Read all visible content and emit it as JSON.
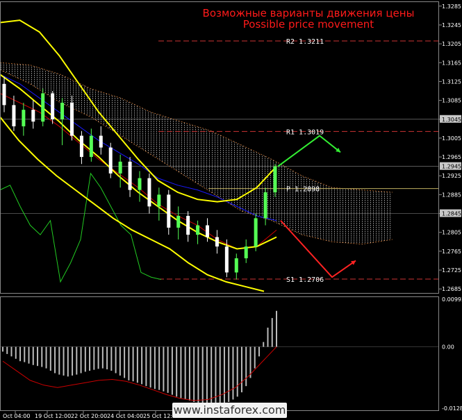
{
  "chart_data": {
    "type": "line",
    "title": "Возможные варианты движения цены",
    "subtitle": "Possible price movement",
    "colors": {
      "background": "#000000",
      "grid": "#555555",
      "candle_up": "#55ff55",
      "candle_down": "#ffffff",
      "bollinger": "#ffff00",
      "ma_blue": "#1a1aff",
      "ma_red": "#cc0000",
      "ma_green": "#22cc22",
      "cloud": "#c0c0c0",
      "cloud_edge": "#cc7a3a",
      "resistance_line": "#cc3333",
      "pivot_line": "#c0b060",
      "arrow_up": "#33ee33",
      "arrow_down": "#ff2222"
    },
    "price_axis": {
      "ticks": [
        "1.3285",
        "1.3245",
        "1.3205",
        "1.3165",
        "1.3125",
        "1.3085",
        "1.3045",
        "1.3005",
        "1.2965",
        "1.2925",
        "1.2885",
        "1.2845",
        "1.2805",
        "1.2765",
        "1.2725",
        "1.2685"
      ],
      "ylim": [
        1.2675,
        1.3295
      ],
      "current_labels": [
        "1.3045",
        "1.2945",
        "1.2845"
      ]
    },
    "levels": [
      {
        "name": "R2",
        "label": "R2 1.3211",
        "value": 1.3211
      },
      {
        "name": "R1",
        "label": "R1 1.3019",
        "value": 1.3019
      },
      {
        "name": "P",
        "label": "P 1.2898",
        "value": 1.2898
      },
      {
        "name": "S1",
        "label": "S1 1.2706",
        "value": 1.2706
      }
    ],
    "time_axis": {
      "labels": [
        "Oct 04:00",
        "19 Oct 12:00",
        "22 Oct 20:00",
        "24 Oct 04:00",
        "25 Oct 12:00"
      ]
    },
    "candles": [
      {
        "o": 1.312,
        "h": 1.3135,
        "l": 1.306,
        "c": 1.3075
      },
      {
        "o": 1.3075,
        "h": 1.3095,
        "l": 1.302,
        "c": 1.303
      },
      {
        "o": 1.303,
        "h": 1.308,
        "l": 1.301,
        "c": 1.3065
      },
      {
        "o": 1.3065,
        "h": 1.3085,
        "l": 1.3025,
        "c": 1.304
      },
      {
        "o": 1.304,
        "h": 1.311,
        "l": 1.303,
        "c": 1.31
      },
      {
        "o": 1.31,
        "h": 1.3105,
        "l": 1.3035,
        "c": 1.3045
      },
      {
        "o": 1.3045,
        "h": 1.309,
        "l": 1.299,
        "c": 1.308
      },
      {
        "o": 1.308,
        "h": 1.3095,
        "l": 1.3,
        "c": 1.301
      },
      {
        "o": 1.301,
        "h": 1.302,
        "l": 1.295,
        "c": 1.2965
      },
      {
        "o": 1.2965,
        "h": 1.3025,
        "l": 1.2955,
        "c": 1.301
      },
      {
        "o": 1.301,
        "h": 1.303,
        "l": 1.297,
        "c": 1.2985
      },
      {
        "o": 1.2985,
        "h": 1.2995,
        "l": 1.292,
        "c": 1.293
      },
      {
        "o": 1.293,
        "h": 1.297,
        "l": 1.29,
        "c": 1.2955
      },
      {
        "o": 1.2955,
        "h": 1.2965,
        "l": 1.288,
        "c": 1.2895
      },
      {
        "o": 1.2895,
        "h": 1.2935,
        "l": 1.287,
        "c": 1.292
      },
      {
        "o": 1.292,
        "h": 1.293,
        "l": 1.2845,
        "c": 1.286
      },
      {
        "o": 1.286,
        "h": 1.29,
        "l": 1.283,
        "c": 1.2885
      },
      {
        "o": 1.2885,
        "h": 1.2895,
        "l": 1.28,
        "c": 1.2815
      },
      {
        "o": 1.2815,
        "h": 1.286,
        "l": 1.279,
        "c": 1.284
      },
      {
        "o": 1.284,
        "h": 1.285,
        "l": 1.2785,
        "c": 1.28
      },
      {
        "o": 1.28,
        "h": 1.283,
        "l": 1.278,
        "c": 1.282
      },
      {
        "o": 1.282,
        "h": 1.2835,
        "l": 1.2785,
        "c": 1.2795
      },
      {
        "o": 1.2795,
        "h": 1.281,
        "l": 1.276,
        "c": 1.2775
      },
      {
        "o": 1.2775,
        "h": 1.279,
        "l": 1.271,
        "c": 1.272
      },
      {
        "o": 1.272,
        "h": 1.276,
        "l": 1.2705,
        "c": 1.275
      },
      {
        "o": 1.275,
        "h": 1.279,
        "l": 1.274,
        "c": 1.2775
      },
      {
        "o": 1.2775,
        "h": 1.2845,
        "l": 1.2765,
        "c": 1.2835
      },
      {
        "o": 1.2835,
        "h": 1.29,
        "l": 1.282,
        "c": 1.289
      },
      {
        "o": 1.289,
        "h": 1.295,
        "l": 1.288,
        "c": 1.2945
      }
    ],
    "cloud": {
      "upper": [
        1.3165,
        1.316,
        1.314,
        1.311,
        1.309,
        1.306,
        1.304,
        1.302,
        1.299,
        1.296,
        1.2925,
        1.29,
        1.2895,
        1.289
      ],
      "lower": [
        1.315,
        1.312,
        1.308,
        1.305,
        1.301,
        1.297,
        1.293,
        1.289,
        1.285,
        1.283,
        1.28,
        1.2785,
        1.278,
        1.279
      ]
    },
    "bollinger": {
      "upper": [
        1.325,
        1.3255,
        1.323,
        1.318,
        1.312,
        1.306,
        1.301,
        1.296,
        1.2915,
        1.289,
        1.2875,
        1.287,
        1.2875,
        1.29,
        1.2945
      ],
      "middle": [
        1.314,
        1.311,
        1.3075,
        1.304,
        1.3,
        1.2965,
        1.2925,
        1.289,
        1.286,
        1.283,
        1.2805,
        1.2785,
        1.277,
        1.2775,
        1.2795
      ],
      "lower": [
        1.305,
        1.3,
        1.296,
        1.2925,
        1.2895,
        1.2865,
        1.2835,
        1.281,
        1.279,
        1.277,
        1.274,
        1.2715,
        1.27,
        1.269,
        1.268
      ]
    },
    "ma_blue": [
      1.314,
      1.312,
      1.309,
      1.306,
      1.303,
      1.3,
      1.2975,
      1.295,
      1.292,
      1.2905,
      1.2895,
      1.288,
      1.286,
      1.284,
      1.283
    ],
    "ma_red": [
      1.31,
      1.308,
      1.306,
      1.303,
      1.2995,
      1.296,
      1.293,
      1.29,
      1.2865,
      1.284,
      1.282,
      1.279,
      1.277,
      1.2775,
      1.281
    ],
    "ma_green": [
      1.2895,
      1.2905,
      1.286,
      1.282,
      1.28,
      1.283,
      1.27,
      1.274,
      1.279,
      1.293,
      1.29,
      1.286,
      1.282,
      1.28,
      1.272,
      1.271,
      1.2705
    ],
    "scenarios": {
      "up": [
        1.2945,
        1.301,
        1.2975
      ],
      "down": [
        1.283,
        1.271,
        1.2745
      ]
    },
    "oscillator": {
      "ticks": [
        "0.00993",
        "0.00",
        "-0.01281"
      ],
      "ylim": [
        -0.01281,
        0.00993
      ],
      "histogram": [
        -0.001,
        -0.0015,
        -0.002,
        -0.0025,
        -0.003,
        -0.0032,
        -0.0035,
        -0.0038,
        -0.004,
        -0.0042,
        -0.0045,
        -0.005,
        -0.0055,
        -0.0058,
        -0.006,
        -0.0062,
        -0.006,
        -0.0058,
        -0.0055,
        -0.0052,
        -0.005,
        -0.0048,
        -0.0046,
        -0.0045,
        -0.0047,
        -0.005,
        -0.0055,
        -0.006,
        -0.0065,
        -0.007,
        -0.0072,
        -0.0075,
        -0.0078,
        -0.0082,
        -0.0085,
        -0.0088,
        -0.009,
        -0.0093,
        -0.0096,
        -0.01,
        -0.0104,
        -0.0107,
        -0.011,
        -0.0112,
        -0.0115,
        -0.0118,
        -0.012,
        -0.0122,
        -0.0124,
        -0.0123,
        -0.0121,
        -0.0118,
        -0.0115,
        -0.011,
        -0.0104,
        -0.0095,
        -0.0082,
        -0.0065,
        -0.0045,
        -0.002,
        0.001,
        0.004,
        0.006,
        0.0075
      ],
      "signal": [
        -0.003,
        -0.005,
        -0.007,
        -0.008,
        -0.0085,
        -0.008,
        -0.0075,
        -0.007,
        -0.0068,
        -0.0072,
        -0.008,
        -0.009,
        -0.01,
        -0.0108,
        -0.0112,
        -0.011,
        -0.01,
        -0.0085,
        -0.006,
        -0.003,
        0.0
      ]
    }
  },
  "watermark": "www.instaforex.com"
}
